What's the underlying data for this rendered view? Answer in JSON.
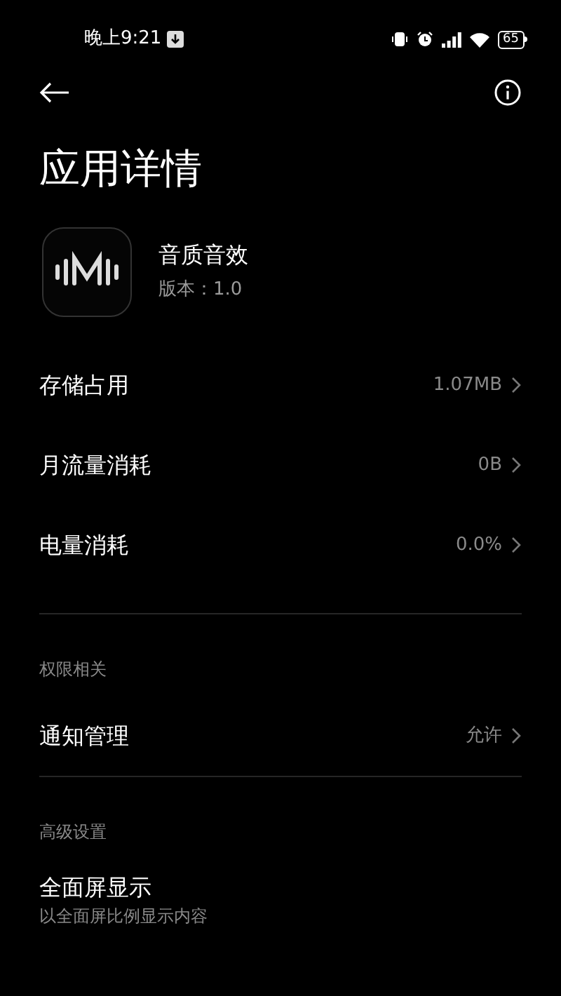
{
  "status_bar": {
    "time": "晚上9:21",
    "battery": "65"
  },
  "title": "应用详情",
  "app": {
    "name": "音质音效",
    "version": "版本：1.0"
  },
  "sections": [
    {
      "items": [
        {
          "kind": "value",
          "label": "存储占用",
          "value": "1.07MB"
        },
        {
          "kind": "value",
          "label": "月流量消耗",
          "value": "0B"
        },
        {
          "kind": "value",
          "label": "电量消耗",
          "value": "0.0%"
        }
      ]
    },
    {
      "header": "权限相关",
      "items": [
        {
          "kind": "value",
          "label": "通知管理",
          "value": "允许"
        }
      ]
    },
    {
      "header": "高级设置",
      "items": [
        {
          "kind": "subtitle",
          "label": "全面屏显示",
          "subtitle": "以全面屏比例显示内容"
        }
      ]
    }
  ]
}
